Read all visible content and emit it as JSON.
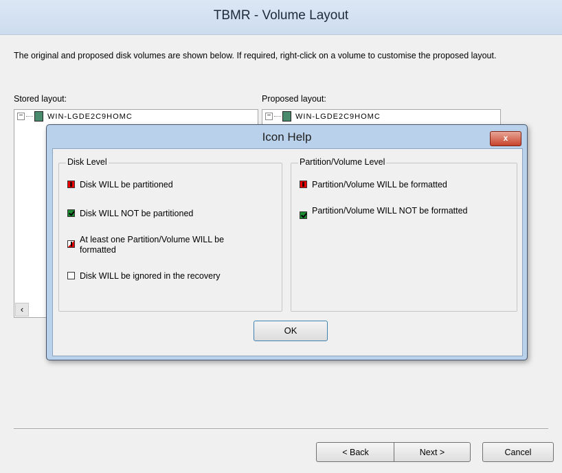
{
  "window": {
    "title": "TBMR - Volume Layout"
  },
  "description": "The original and proposed disk volumes are shown below. If required, right-click on a volume to customise the proposed layout.",
  "stored": {
    "label": "Stored layout:",
    "node": "WIN-LGDE2C9HOMC"
  },
  "proposed": {
    "label": "Proposed layout:",
    "node": "WIN-LGDE2C9HOMC"
  },
  "buttons": {
    "back": "< Back",
    "next": "Next >",
    "cancel": "Cancel"
  },
  "dialog": {
    "title": "Icon Help",
    "close": "x",
    "disk_level": {
      "title": "Disk Level",
      "items": [
        {
          "icon": "red-exclamation-icon",
          "text": "Disk WILL be partitioned"
        },
        {
          "icon": "green-check-icon",
          "text": "Disk WILL NOT be partitioned"
        },
        {
          "icon": "half-red-exclamation-icon",
          "text": "At least one Partition/Volume WILL be formatted"
        },
        {
          "icon": "empty-box-icon",
          "text": "Disk WILL be ignored in the recovery"
        }
      ]
    },
    "partition_level": {
      "title": "Partition/Volume  Level",
      "items": [
        {
          "icon": "red-exclamation-icon",
          "text": "Partition/Volume WILL be formatted"
        },
        {
          "icon": "green-check-icon",
          "text": "Partition/Volume WILL NOT be formatted"
        }
      ]
    },
    "ok": "OK"
  },
  "colors": {
    "dialog_frame": "#b9d1ea",
    "close_button": "#c7432c",
    "accent_red": "#e00000",
    "accent_green": "#1d8a32"
  }
}
